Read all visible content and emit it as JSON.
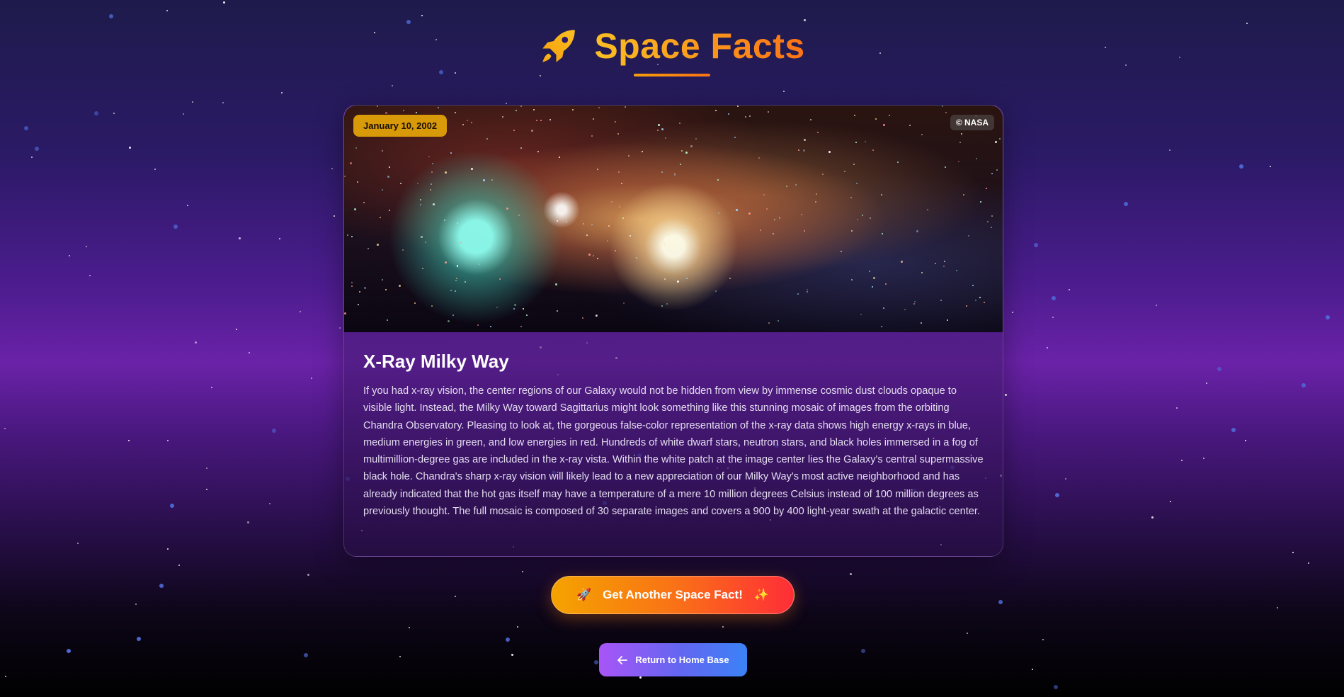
{
  "header": {
    "title": "Space Facts",
    "icon": "rocket-icon"
  },
  "fact": {
    "date": "January 10, 2002",
    "credit": "© NASA",
    "title": "X-Ray Milky Way",
    "description": "If you had x-ray vision, the center regions of our Galaxy would not be hidden from view by immense cosmic dust clouds opaque to visible light. Instead, the Milky Way toward Sagittarius might look something like this stunning mosaic of images from the orbiting Chandra Observatory. Pleasing to look at, the gorgeous false-color representation of the x-ray data shows high energy x-rays in blue, medium energies in green, and low energies in red. Hundreds of white dwarf stars, neutron stars, and black holes immersed in a fog of multimillion-degree gas are included in the x-ray vista. Within the white patch at the image center lies the Galaxy's central supermassive black hole. Chandra's sharp x-ray vision will likely lead to a new appreciation of our Milky Way's most active neighborhood and has already indicated that the hot gas itself may have a temperature of a mere 10 million degrees Celsius instead of 100 million degrees as previously thought. The full mosaic is composed of 30 separate images and covers a 900 by 400 light-year swath at the galactic center."
  },
  "actions": {
    "another_label": "Get Another Space Fact!",
    "another_icon_left": "🚀",
    "another_icon_right": "✨",
    "home_label": "Return to Home Base",
    "home_icon": "arrow-left-icon"
  },
  "colors": {
    "title_accent": "#f59e0b",
    "date_badge": "#d99a0a",
    "primary_button_start": "#f5a300",
    "primary_button_end": "#ff2d37",
    "home_button_start": "#a855f7",
    "home_button_end": "#3b82f6"
  }
}
